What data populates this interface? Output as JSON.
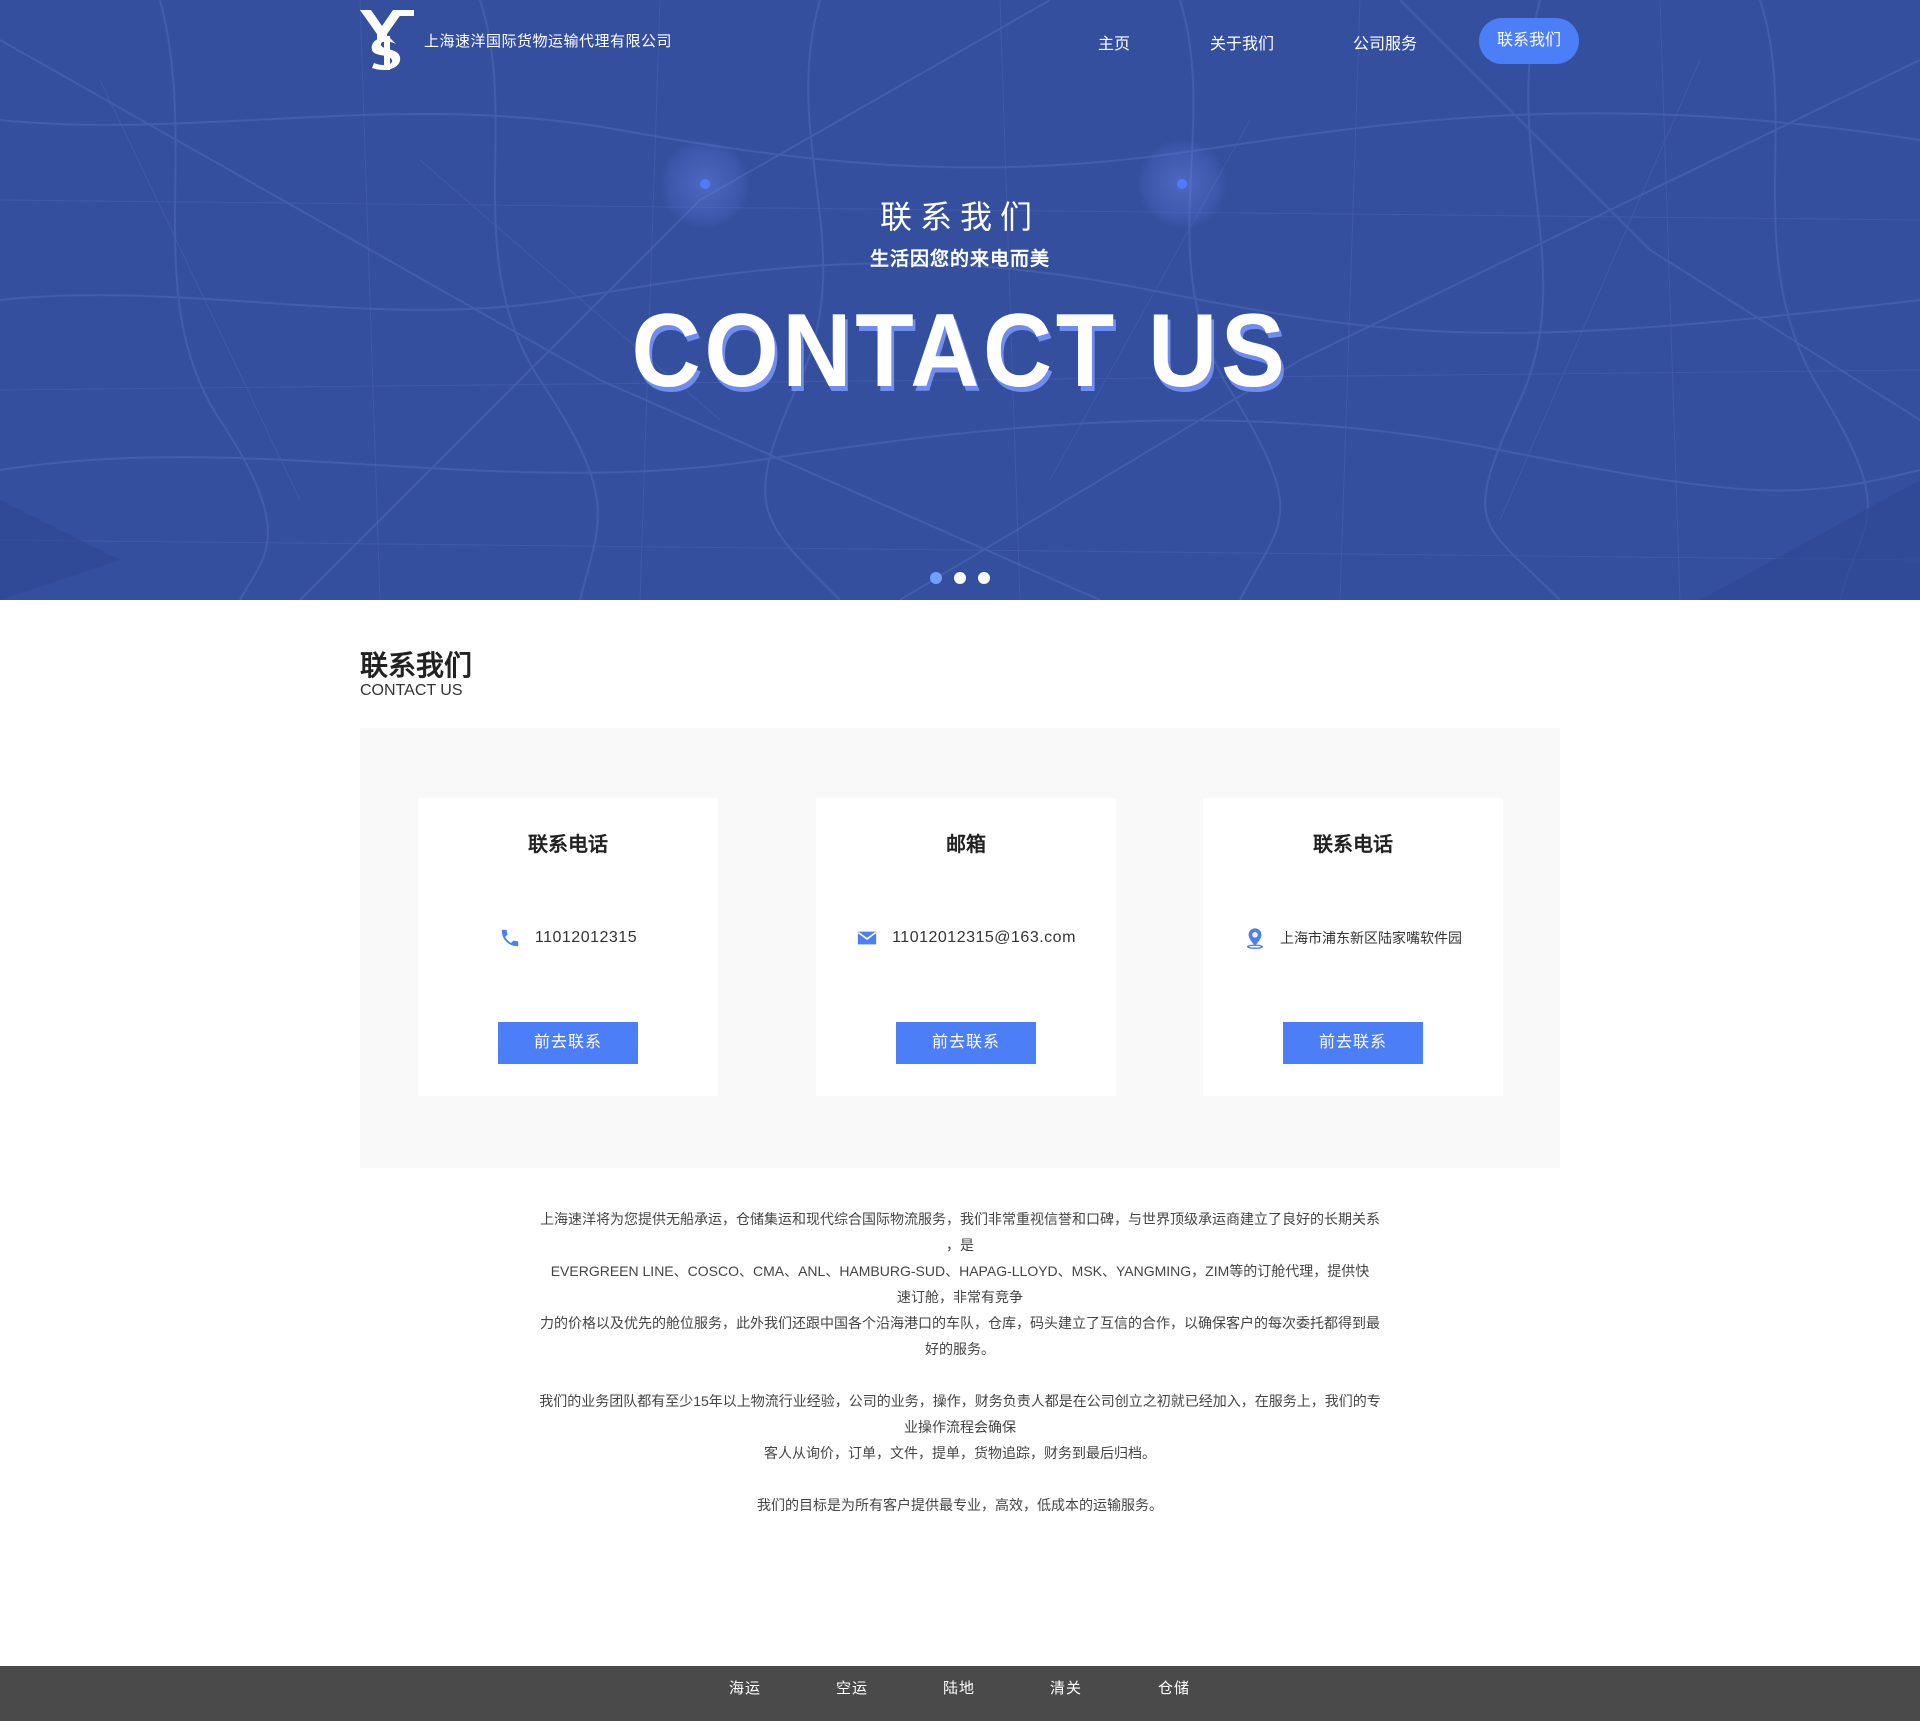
{
  "header": {
    "company_name": "上海速洋国际货物运输代理有限公司",
    "nav": {
      "home": "主页",
      "about": "关于我们",
      "service": "公司服务",
      "contact": "联系我们"
    }
  },
  "hero": {
    "title": "联系我们",
    "subtitle": "生活因您的来电而美",
    "big_text": "CONTACT US",
    "slides_total": 3,
    "active_slide": 1
  },
  "section": {
    "title": "联系我们",
    "subtitle": "CONTACT US"
  },
  "cards": [
    {
      "title": "联系电话",
      "icon": "phone-icon",
      "value": "11012012315",
      "button": "前去联系"
    },
    {
      "title": "邮箱",
      "icon": "mail-icon",
      "value": "11012012315@163.com",
      "button": "前去联系"
    },
    {
      "title": "联系电话",
      "icon": "location-pin-icon",
      "value": "上海市浦东新区陆家嘴软件园",
      "button": "前去联系"
    }
  ],
  "description": {
    "lines": [
      "上海速洋将为您提供无船承运，仓储集运和现代综合国际物流服务，我们非常重视信誉和口碑，与世界顶级承运商建立了良好的长期关系",
      "，是",
      "EVERGREEN LINE、COSCO、CMA、ANL、HAMBURG-SUD、HAPAG-LLOYD、MSK、YANGMING，ZIM等的订舱代理，提供快",
      "速订舱，非常有竞争",
      "力的价格以及优先的舱位服务，此外我们还跟中国各个沿海港口的车队，仓库，码头建立了互信的合作，以确保客户的每次委托都得到最",
      "好的服务。",
      "我们的业务团队都有至少15年以上物流行业经验，公司的业务，操作，财务负责人都是在公司创立之初就已经加入，在服务上，我们的专",
      "业操作流程会确保",
      "客人从询价，订单，文件，提单，货物追踪，财务到最后归档。",
      "我们的目标是为所有客户提供最专业，高效，低成本的运输服务。"
    ]
  },
  "footer": {
    "items": [
      "海运",
      "空运",
      "陆地",
      "清关",
      "仓储"
    ]
  },
  "colors": {
    "hero_bg": "#354f9f",
    "accent": "#4b7ef7",
    "footer_bg": "#4a4a4a",
    "panel_bg": "#f9f9f9"
  }
}
